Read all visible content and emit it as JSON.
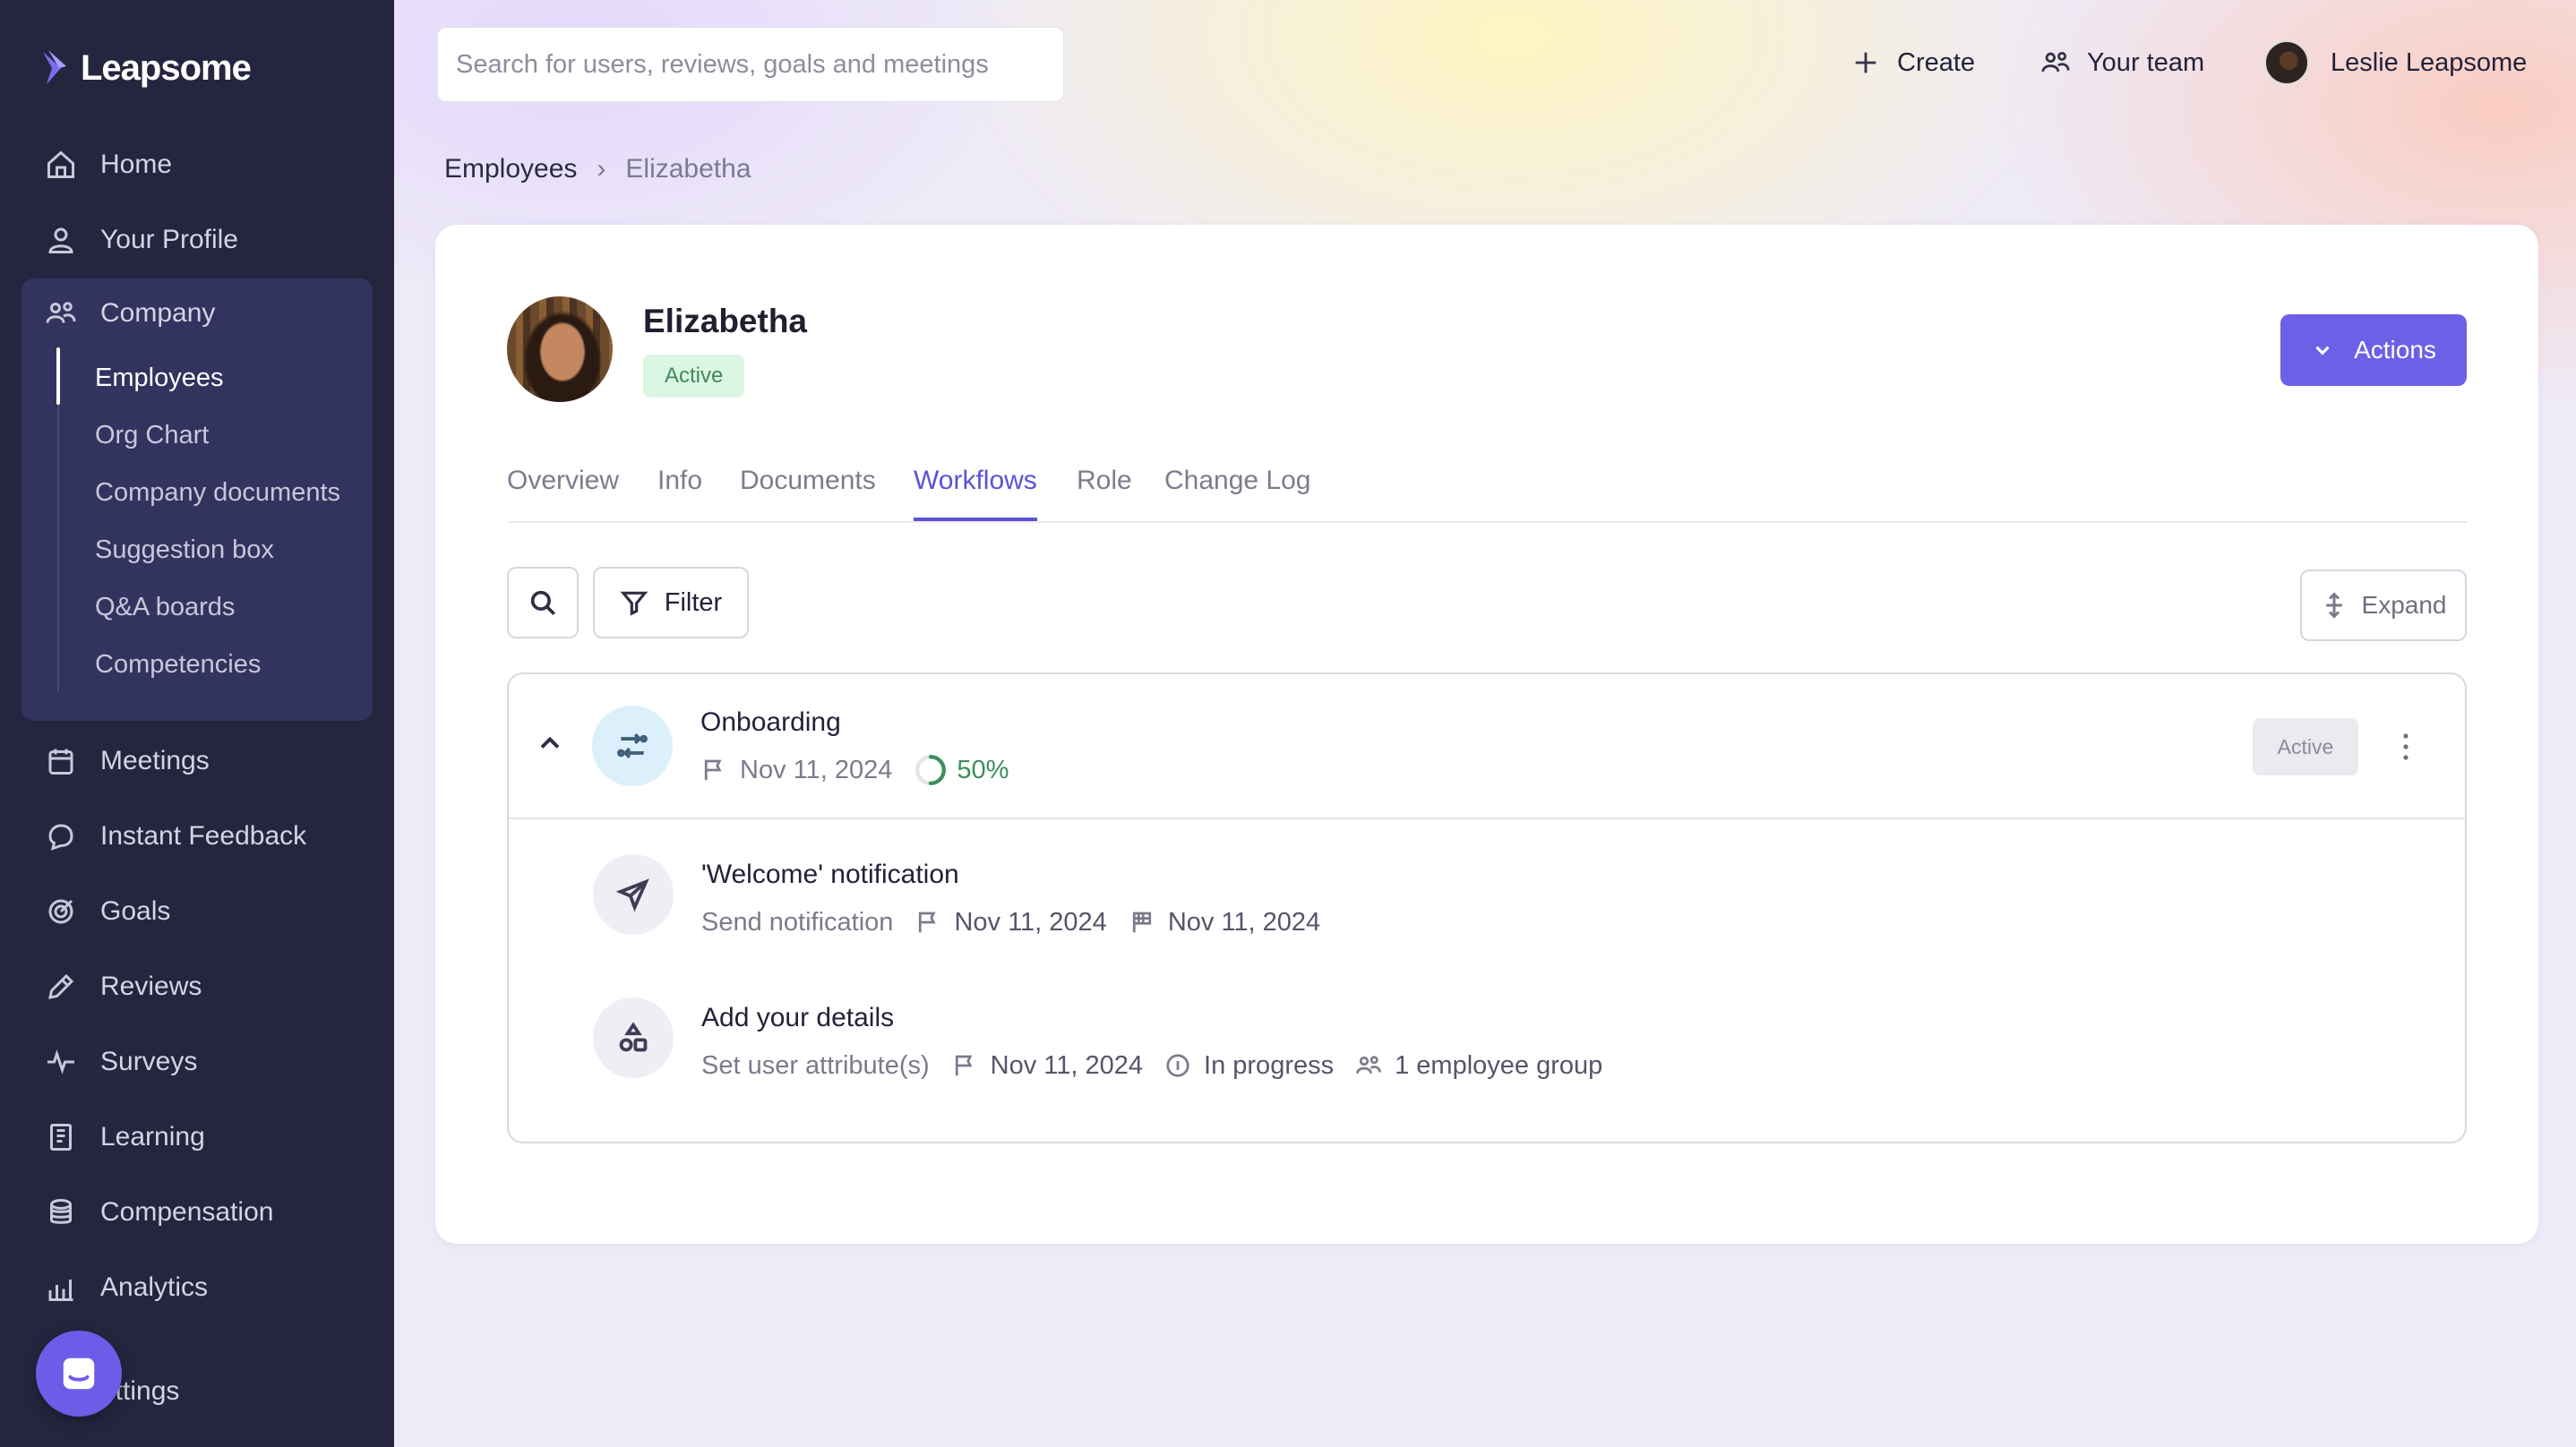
{
  "app": {
    "logo_text": "Leapsome"
  },
  "sidebar": {
    "items": [
      {
        "label": "Home",
        "icon": "home-icon"
      },
      {
        "label": "Your Profile",
        "icon": "user-icon"
      },
      {
        "label": "Company",
        "icon": "users-icon"
      },
      {
        "label": "Meetings",
        "icon": "calendar-icon"
      },
      {
        "label": "Instant Feedback",
        "icon": "chat-icon"
      },
      {
        "label": "Goals",
        "icon": "target-icon"
      },
      {
        "label": "Reviews",
        "icon": "pencil-icon"
      },
      {
        "label": "Surveys",
        "icon": "pulse-icon"
      },
      {
        "label": "Learning",
        "icon": "book-icon"
      },
      {
        "label": "Compensation",
        "icon": "coins-icon"
      },
      {
        "label": "Analytics",
        "icon": "chart-icon"
      },
      {
        "label": "ettings",
        "icon": "gear-icon"
      }
    ],
    "company_subitems": [
      {
        "label": "Employees",
        "active": true
      },
      {
        "label": "Org Chart"
      },
      {
        "label": "Company documents"
      },
      {
        "label": "Suggestion box"
      },
      {
        "label": "Q&A boards"
      },
      {
        "label": "Competencies"
      }
    ]
  },
  "header": {
    "search_placeholder": "Search for users, reviews, goals and meetings",
    "create_label": "Create",
    "team_label": "Your team",
    "user_name": "Leslie Leapsome"
  },
  "breadcrumb": {
    "parent": "Employees",
    "separator": "›",
    "current": "Elizabetha"
  },
  "profile": {
    "name": "Elizabetha",
    "status": "Active",
    "actions_label": "Actions"
  },
  "tabs": [
    {
      "label": "Overview"
    },
    {
      "label": "Info"
    },
    {
      "label": "Documents"
    },
    {
      "label": "Workflows",
      "active": true
    },
    {
      "label": "Role"
    },
    {
      "label": "Change Log"
    }
  ],
  "toolbar": {
    "filter_label": "Filter",
    "expand_label": "Expand"
  },
  "workflow": {
    "title": "Onboarding",
    "date": "Nov 11, 2024",
    "progress_label": "50%",
    "progress": 0.5,
    "status": "Active",
    "steps": [
      {
        "title": "'Welcome' notification",
        "type": "Send notification",
        "start_date": "Nov 11, 2024",
        "end_date": "Nov 11, 2024"
      },
      {
        "title": "Add your details",
        "type": "Set user attribute(s)",
        "start_date": "Nov 11, 2024",
        "state": "In progress",
        "assignee": "1 employee group"
      }
    ]
  },
  "colors": {
    "sidebar_bg": "#25253f",
    "accent": "#6c60e6",
    "active_tab": "#5b52d8",
    "success_text": "#3f8a58",
    "success_bg": "#dcf6e4"
  }
}
